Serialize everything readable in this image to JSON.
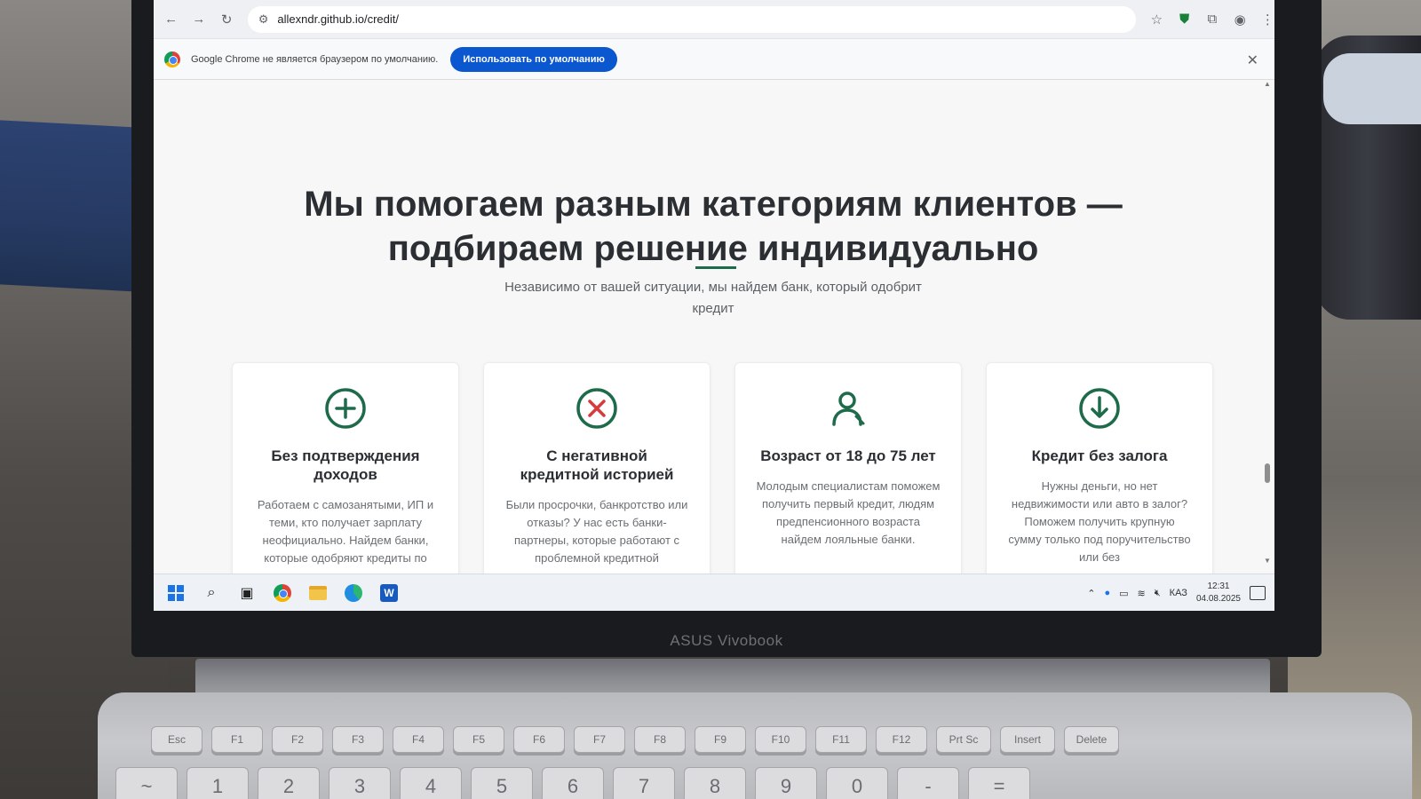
{
  "browser": {
    "url": "allexndr.github.io/credit/",
    "infobar_text": "Google Chrome не является браузером по умолчанию.",
    "infobar_button": "Использовать по умолчанию"
  },
  "hero": {
    "title_line1": "Мы помогаем разным категориям клиентов —",
    "title_line2": "подбираем решение индивидуально",
    "subtitle_line1": "Независимо от вашей ситуации, мы найдем банк, который одобрит",
    "subtitle_line2": "кредит"
  },
  "cards": [
    {
      "icon": "plus-circle-icon",
      "title_line1": "Без подтверждения",
      "title_line2": "доходов",
      "text": "Работаем с самозанятыми, ИП и теми, кто получает зарплату неофициально. Найдем банки, которые одобряют кредиты по"
    },
    {
      "icon": "x-circle-icon",
      "title_line1": "С негативной",
      "title_line2": "кредитной историей",
      "text": "Были просрочки, банкротство или отказы? У нас есть банки-партнеры, которые работают с проблемной кредитной"
    },
    {
      "icon": "user-icon",
      "title_line1": "Возраст от 18 до 75 лет",
      "title_line2": "",
      "text": "Молодым специалистам поможем получить первый кредит, людям предпенсионного возраста найдем лояльные банки."
    },
    {
      "icon": "download-circle-icon",
      "title_line1": "Кредит без залога",
      "title_line2": "",
      "text": "Нужны деньги, но нет недвижимости или авто в залог? Поможем получить крупную сумму только под поручительство или без"
    }
  ],
  "taskbar": {
    "language": "КАЗ",
    "time": "12:31",
    "date": "04.08.2025"
  },
  "laptop": {
    "brand": "ASUS Vivobook"
  },
  "keyboard": {
    "fn_row": [
      "Esc",
      "F1",
      "F2",
      "F3",
      "F4",
      "F5",
      "F6",
      "F7",
      "F8",
      "F9",
      "F10",
      "F11",
      "F12",
      "Prt Sc",
      "Insert",
      "Delete"
    ],
    "num_row": [
      "~",
      "1",
      "2",
      "3",
      "4",
      "5",
      "6",
      "7",
      "8",
      "9",
      "0",
      "-",
      "="
    ]
  },
  "colors": {
    "accent_green": "#1d6b4a",
    "icon_red": "#d93a3a",
    "chrome_blue_button": "#0b57d0"
  }
}
